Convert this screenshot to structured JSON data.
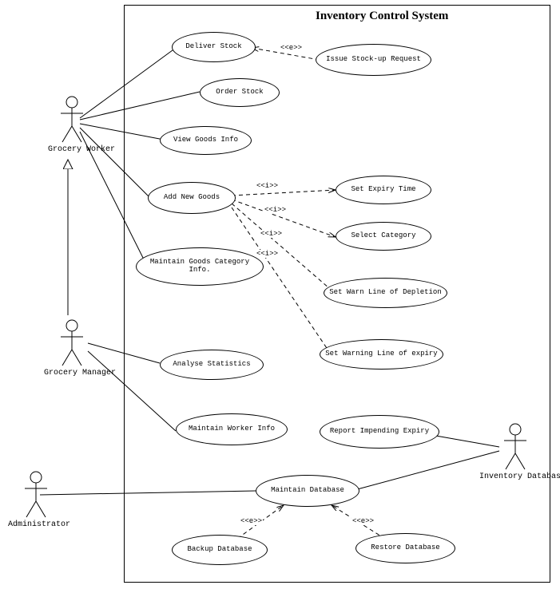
{
  "title": "Inventory Control System",
  "actors": {
    "groceryWorker": "Grocery Worker",
    "groceryManager": "Grocery Manager",
    "administrator": "Administrator",
    "inventoryDatabase": "Inventory Database"
  },
  "usecases": {
    "deliverStock": "Deliver Stock",
    "issueStockup": "Issue Stock-up Request",
    "orderStock": "Order Stock",
    "viewGoods": "View Goods Info",
    "addNewGoods": "Add New Goods",
    "setExpiry": "Set Expiry Time",
    "selectCategory": "Select Category",
    "setWarnDepletion": "Set Warn Line of Depletion",
    "setWarnExpiry": "Set Warning Line of expiry",
    "maintainCategory": "Maintain Goods Category Info.",
    "analyseStats": "Analyse Statistics",
    "maintainWorker": "Maintain Worker Info",
    "reportExpiry": "Report Impending Expiry",
    "maintainDb": "Maintain Database",
    "backupDb": "Backup Database",
    "restoreDb": "Restore Database"
  },
  "stereotypes": {
    "extend": "<<e>>",
    "include": "<<i>>"
  },
  "chart_data": {
    "type": "uml-use-case",
    "system": "Inventory Control System",
    "actors": [
      "Grocery Worker",
      "Grocery Manager",
      "Administrator",
      "Inventory Database"
    ],
    "usecases": [
      "Deliver Stock",
      "Issue Stock-up Request",
      "Order Stock",
      "View Goods Info",
      "Add New Goods",
      "Set Expiry Time",
      "Select Category",
      "Set Warn Line of Depletion",
      "Set Warning Line of expiry",
      "Maintain Goods Category Info.",
      "Analyse Statistics",
      "Maintain Worker Info",
      "Report Impending Expiry",
      "Maintain Database",
      "Backup Database",
      "Restore Database"
    ],
    "associations": [
      {
        "actor": "Grocery Worker",
        "usecase": "Deliver Stock"
      },
      {
        "actor": "Grocery Worker",
        "usecase": "Order Stock"
      },
      {
        "actor": "Grocery Worker",
        "usecase": "View Goods Info"
      },
      {
        "actor": "Grocery Worker",
        "usecase": "Add New Goods"
      },
      {
        "actor": "Grocery Worker",
        "usecase": "Maintain Goods Category Info."
      },
      {
        "actor": "Grocery Manager",
        "usecase": "Analyse Statistics"
      },
      {
        "actor": "Grocery Manager",
        "usecase": "Maintain Worker Info"
      },
      {
        "actor": "Administrator",
        "usecase": "Maintain Database"
      },
      {
        "actor": "Inventory Database",
        "usecase": "Report Impending Expiry"
      },
      {
        "actor": "Inventory Database",
        "usecase": "Maintain Database"
      }
    ],
    "generalizations": [
      {
        "parent": "Grocery Worker",
        "child": "Grocery Manager"
      }
    ],
    "extends": [
      {
        "from": "Issue Stock-up Request",
        "to": "Deliver Stock",
        "stereotype": "<<e>>"
      },
      {
        "from": "Backup Database",
        "to": "Maintain Database",
        "stereotype": "<<e>>"
      },
      {
        "from": "Restore Database",
        "to": "Maintain Database",
        "stereotype": "<<e>>"
      }
    ],
    "includes": [
      {
        "from": "Add New Goods",
        "to": "Set Expiry Time",
        "stereotype": "<<i>>"
      },
      {
        "from": "Add New Goods",
        "to": "Select Category",
        "stereotype": "<<i>>"
      },
      {
        "from": "Add New Goods",
        "to": "Set Warn Line of Depletion",
        "stereotype": "<<i>>"
      },
      {
        "from": "Add New Goods",
        "to": "Set Warning Line of expiry",
        "stereotype": "<<i>>"
      }
    ]
  }
}
